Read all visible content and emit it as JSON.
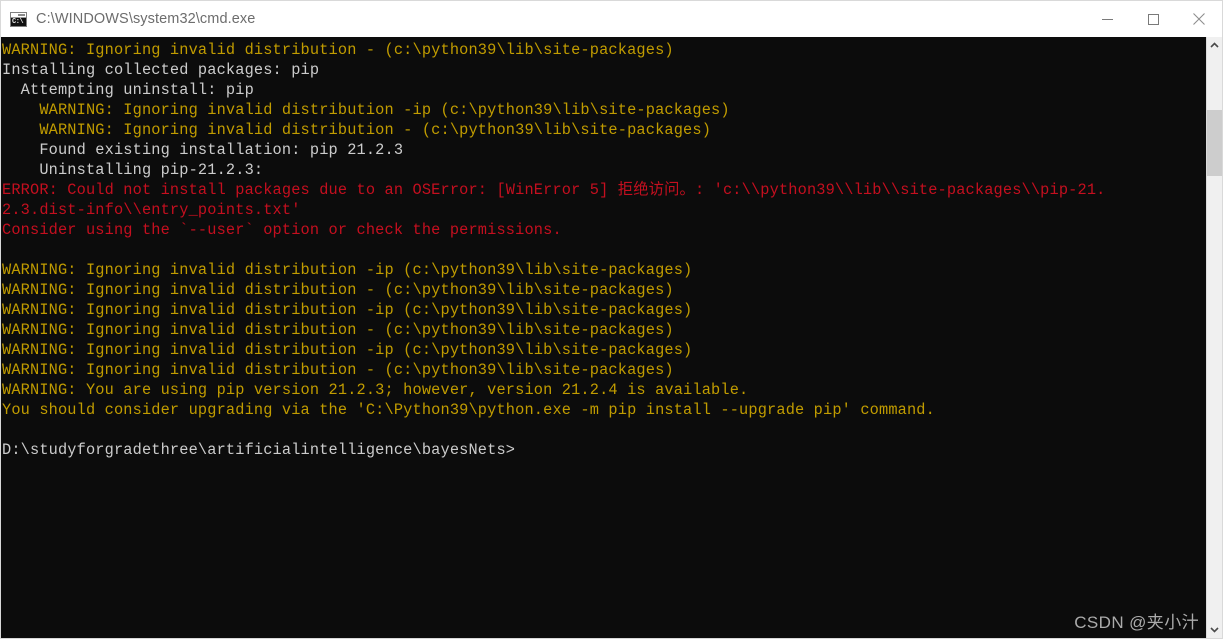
{
  "window": {
    "title": "C:\\WINDOWS\\system32\\cmd.exe",
    "icon": "cmd-icon",
    "icon_glyph": "C:\\",
    "background_color": "#0c0c0c",
    "titlebar_color": "#ffffff"
  },
  "window_controls": {
    "minimize_label": "Minimize",
    "maximize_label": "Maximize",
    "close_label": "Close"
  },
  "colors": {
    "text_default": "#cccccc",
    "warning": "#c19c00",
    "error": "#c50f1f",
    "scrollbar_thumb": "#cdcdcd"
  },
  "console": {
    "lines": [
      {
        "text": "WARNING: Ignoring invalid distribution - (c:\\python39\\lib\\site-packages)",
        "color": "warning"
      },
      {
        "text": "Installing collected packages: pip",
        "color": "default"
      },
      {
        "text": "  Attempting uninstall: pip",
        "color": "default"
      },
      {
        "text": "    WARNING: Ignoring invalid distribution -ip (c:\\python39\\lib\\site-packages)",
        "color": "warning"
      },
      {
        "text": "    WARNING: Ignoring invalid distribution - (c:\\python39\\lib\\site-packages)",
        "color": "warning"
      },
      {
        "text": "    Found existing installation: pip 21.2.3",
        "color": "default"
      },
      {
        "text": "    Uninstalling pip-21.2.3:",
        "color": "default"
      },
      {
        "text": "ERROR: Could not install packages due to an OSError: [WinError 5] 拒绝访问。: 'c:\\\\python39\\\\lib\\\\site-packages\\\\pip-21.",
        "color": "error"
      },
      {
        "text": "2.3.dist-info\\\\entry_points.txt'",
        "color": "error"
      },
      {
        "text": "Consider using the `--user` option or check the permissions.",
        "color": "error"
      },
      {
        "text": "",
        "color": "default"
      },
      {
        "text": "WARNING: Ignoring invalid distribution -ip (c:\\python39\\lib\\site-packages)",
        "color": "warning"
      },
      {
        "text": "WARNING: Ignoring invalid distribution - (c:\\python39\\lib\\site-packages)",
        "color": "warning"
      },
      {
        "text": "WARNING: Ignoring invalid distribution -ip (c:\\python39\\lib\\site-packages)",
        "color": "warning"
      },
      {
        "text": "WARNING: Ignoring invalid distribution - (c:\\python39\\lib\\site-packages)",
        "color": "warning"
      },
      {
        "text": "WARNING: Ignoring invalid distribution -ip (c:\\python39\\lib\\site-packages)",
        "color": "warning"
      },
      {
        "text": "WARNING: Ignoring invalid distribution - (c:\\python39\\lib\\site-packages)",
        "color": "warning"
      },
      {
        "text": "WARNING: You are using pip version 21.2.3; however, version 21.2.4 is available.",
        "color": "warning"
      },
      {
        "text": "You should consider upgrading via the 'C:\\Python39\\python.exe -m pip install --upgrade pip' command.",
        "color": "warning"
      },
      {
        "text": "",
        "color": "default"
      },
      {
        "text": "D:\\studyforgradethree\\artificialintelligence\\bayesNets>",
        "color": "default"
      }
    ]
  },
  "scrollbar": {
    "up_arrow": "chevron-up-icon",
    "down_arrow": "chevron-down-icon"
  },
  "watermark": {
    "text": "CSDN @夹小汁"
  }
}
